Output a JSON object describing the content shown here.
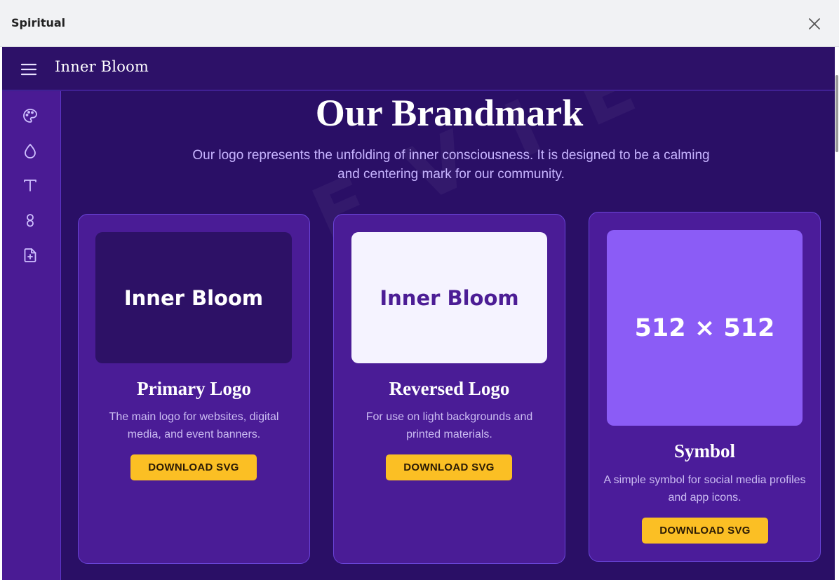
{
  "window": {
    "title": "Spiritual"
  },
  "topbar": {
    "brand": "Inner Bloom"
  },
  "sidebar": {
    "icons": [
      "palette-icon",
      "droplet-icon",
      "type-icon",
      "infinity-icon",
      "file-plus-icon"
    ]
  },
  "page": {
    "heading": "Our Brandmark",
    "subtitle": "Our logo represents the unfolding of inner consciousness. It is designed to be a calming and centering mark for our community.",
    "watermark": "PREVIEW"
  },
  "cards": [
    {
      "preview_text": "Inner Bloom",
      "title": "Primary Logo",
      "description": "The main logo for websites, digital media, and event banners.",
      "button": "DOWNLOAD SVG"
    },
    {
      "preview_text": "Inner Bloom",
      "title": "Reversed Logo",
      "description": "For use on light backgrounds and printed materials.",
      "button": "DOWNLOAD SVG"
    },
    {
      "preview_text": "512 × 512",
      "title": "Symbol",
      "description": "A simple symbol for social media profiles and app icons.",
      "button": "DOWNLOAD SVG"
    }
  ],
  "colors": {
    "background": "#2a0f66",
    "card": "#4a1c96",
    "accent": "#fbbf24",
    "symbol_preview": "#8b5cf6",
    "reversed_preview": "#f5f3ff",
    "subtitle": "#c7b4ff"
  }
}
